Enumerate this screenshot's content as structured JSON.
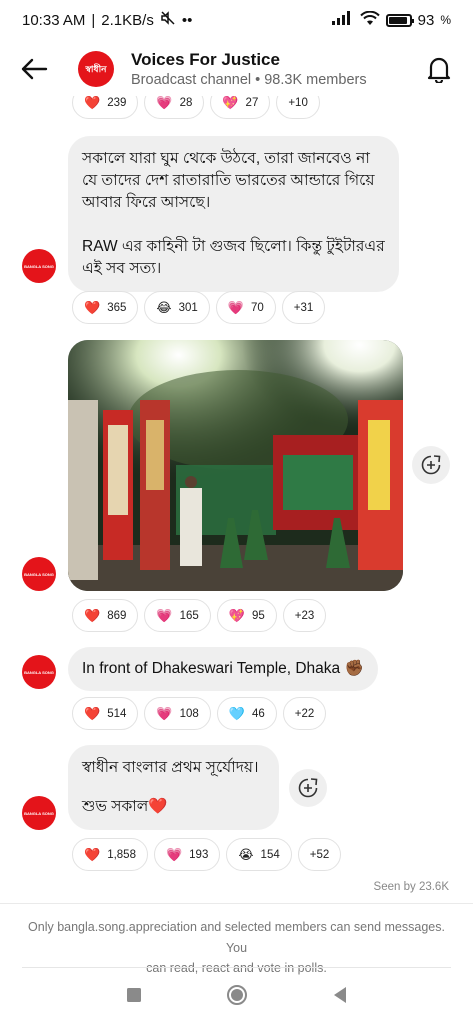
{
  "status": {
    "time": "10:33 AM",
    "speed": "2.1KB/s",
    "dots": "••",
    "battery": "93"
  },
  "header": {
    "channel_name": "Voices For Justice",
    "channel_sub": "Broadcast channel • 98.3K members",
    "avatar_text": "স্বাধীন"
  },
  "messages": {
    "prev_reactions": [
      {
        "emoji": "❤️",
        "count": "239"
      },
      {
        "emoji": "💗",
        "count": "28"
      },
      {
        "emoji": "💖",
        "count": "27"
      },
      {
        "emoji": "",
        "count": "+10"
      }
    ],
    "msg1": {
      "line1": "সকালে যারা ঘুম থেকে উঠবে, তারা জানবেও না",
      "line2": "যে তাদের দেশ রাতারাতি ভারতের আন্ডারে গিয়ে",
      "line3": "আবার ফিরে আসছে।",
      "line4": "RAW এর কাহিনী টা গুজব ছিলো। কিন্তু টুইটারএর",
      "line5": "এই সব সত্য।",
      "reactions": [
        {
          "emoji": "❤️",
          "count": "365"
        },
        {
          "emoji": "😂",
          "count": "301"
        },
        {
          "emoji": "💗",
          "count": "70"
        },
        {
          "emoji": "",
          "count": "+31"
        }
      ]
    },
    "msg2": {
      "reactions": [
        {
          "emoji": "❤️",
          "count": "869"
        },
        {
          "emoji": "💗",
          "count": "165"
        },
        {
          "emoji": "💖",
          "count": "95"
        },
        {
          "emoji": "",
          "count": "+23"
        }
      ]
    },
    "msg3": {
      "text": "In front of Dhakeswari Temple, Dhaka ✊🏾",
      "reactions": [
        {
          "emoji": "❤️",
          "count": "514"
        },
        {
          "emoji": "💗",
          "count": "108"
        },
        {
          "emoji": "🩵",
          "count": "46"
        },
        {
          "emoji": "",
          "count": "+22"
        }
      ]
    },
    "msg4": {
      "line1": "স্বাধীন বাংলার প্রথম সূর্যোদয়।",
      "line2": "শুভ সকাল❤️",
      "reactions": [
        {
          "emoji": "❤️",
          "count": "1,858"
        },
        {
          "emoji": "💗",
          "count": "193"
        },
        {
          "emoji": "😭",
          "count": "154"
        },
        {
          "emoji": "",
          "count": "+52"
        }
      ]
    },
    "seen_by": "Seen by 23.6K"
  },
  "footer": {
    "line1": "Only bangla.song.appreciation and selected members can send messages. You",
    "line2": "can read, react and vote in polls."
  },
  "colors": {
    "accent_red": "#e4141a",
    "bubble_bg": "#efefef"
  }
}
